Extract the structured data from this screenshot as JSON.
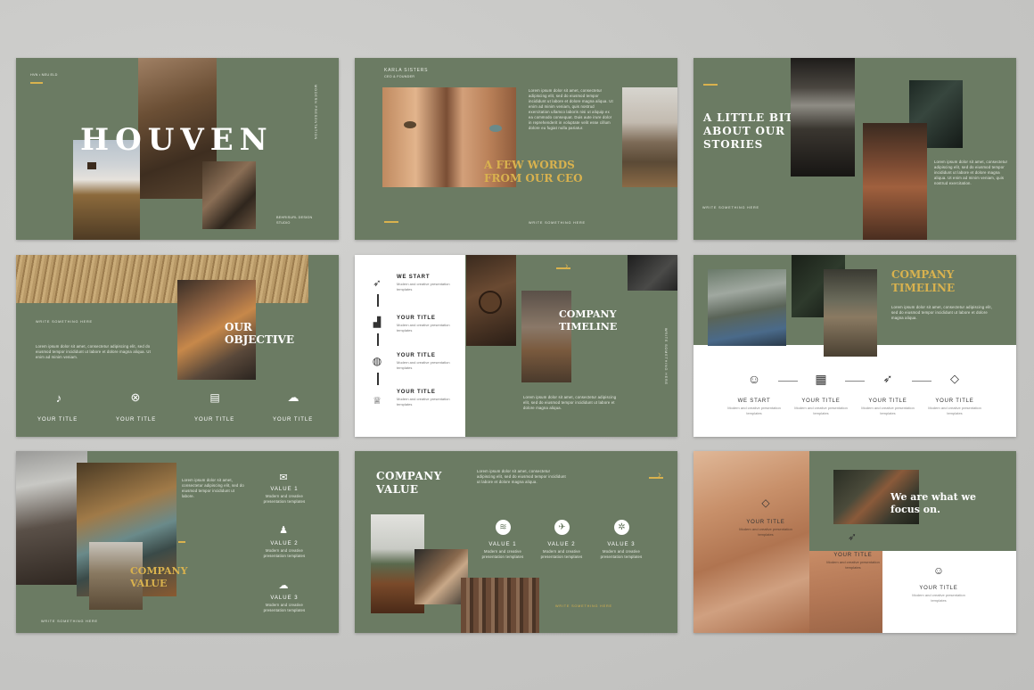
{
  "slide1": {
    "brand_small": "HVN • NEU ELD",
    "title": "HOUVEN",
    "vertical": "MODERN PRESENTATION",
    "studio": "BEHRISURL DESIGN STUDIO"
  },
  "slide2": {
    "name": "KARLA SISTERS",
    "role": "CEO & FOUNDER",
    "heading1": "A FEW WORDS",
    "heading2": "FROM OUR CEO",
    "body": "Lorem ipsum dolor sit amet, consectetur adipiscing elit, sed do eiusmod tempor incididunt ut labore et dolore magna aliqua. Ut enim ad minim veniam, quis nostrud exercitation ullamco laboris nisi ut aliquip ex ea commodo consequat. Duis aute irure dolor in reprehenderit in voluptate velit esse cillum dolore eu fugiat nulla pariatur.",
    "footer": "WRITE SOMETHING HERE"
  },
  "slide3": {
    "heading1": "A LITTLE BIT",
    "heading2": "ABOUT OUR",
    "heading3": "STORIES",
    "footer": "WRITE SOMETHING HERE",
    "body": "Lorem ipsum dolor sit amet, consectetur adipiscing elit, sed do eiusmod tempor incididunt ut labore et dolore magna aliqua. Ut enim ad minim veniam, quis nostrud exercitation."
  },
  "slide4": {
    "footer": "WRITE SOMETHING HERE",
    "body": "Lorem ipsum dolor sit amet, consectetur adipiscing elit, sed do eiusmod tempor incididunt ut labore et dolore magna aliqua. Ut enim ad minim veniam.",
    "heading1": "OUR",
    "heading2": "OBJECTIVE",
    "items": [
      {
        "label": "YOUR TITLE",
        "icon": "music-note-icon"
      },
      {
        "label": "YOUR TITLE",
        "icon": "ball-icon"
      },
      {
        "label": "YOUR TITLE",
        "icon": "document-icon"
      },
      {
        "label": "YOUR TITLE",
        "icon": "cloud-upload-icon"
      }
    ]
  },
  "slide5": {
    "steps": [
      {
        "title": "WE START",
        "sub": "Modern and creative presentation templates",
        "icon": "rocket-icon"
      },
      {
        "title": "YOUR TITLE",
        "sub": "Modern and creative presentation templates",
        "icon": "bar-chart-icon"
      },
      {
        "title": "YOUR TITLE",
        "sub": "Modern and creative presentation templates",
        "icon": "globe-icon"
      },
      {
        "title": "YOUR TITLE",
        "sub": "Modern and creative presentation templates",
        "icon": "trophy-icon"
      }
    ],
    "heading1": "COMPANY",
    "heading2": "TIMELINE",
    "vertical": "WRITE SOMETHING HERE",
    "body": "Lorem ipsum dolor sit amet, consectetur adipiscing elit, sed do eiusmod tempor incididunt ut labore et dolore magna aliqua."
  },
  "slide6": {
    "heading1": "COMPANY",
    "heading2": "TIMELINE",
    "body": "Lorem ipsum dolor sit amet, consectetur adipiscing elit, sed do eiusmod tempor incididunt ut labore et dolore magna aliqua.",
    "items": [
      {
        "title": "WE START",
        "sub": "Modern and creative presentation templates",
        "icon": "head-icon"
      },
      {
        "title": "YOUR TITLE",
        "sub": "Modern and creative presentation templates",
        "icon": "map-icon"
      },
      {
        "title": "YOUR TITLE",
        "sub": "Modern and creative presentation templates",
        "icon": "rocket-icon"
      },
      {
        "title": "YOUR TITLE",
        "sub": "Modern and creative presentation templates",
        "icon": "diamond-icon"
      }
    ]
  },
  "slide7": {
    "body": "Lorem ipsum dolor sit amet, consectetur adipiscing elit, sed do eiusmod tempor incididunt ut labore.",
    "heading1": "COMPANY",
    "heading2": "VALUE",
    "footer": "WRITE SOMETHING HERE",
    "values": [
      {
        "title": "VALUE 1",
        "sub": "Modern and creative presentation templates",
        "icon": "envelope-icon"
      },
      {
        "title": "VALUE 2",
        "sub": "Modern and creative presentation templates",
        "icon": "users-icon"
      },
      {
        "title": "VALUE 3",
        "sub": "Modern and creative presentation templates",
        "icon": "cloud-upload-icon"
      }
    ]
  },
  "slide8": {
    "heading1": "COMPANY",
    "heading2": "VALUE",
    "body": "Lorem ipsum dolor sit amet, consectetur adipiscing elit, sed do eiusmod tempor incididunt ut labore et dolore magna aliqua.",
    "footer": "WRITE SOMETHING HERE",
    "values": [
      {
        "title": "VALUE 1",
        "sub": "Modern and creative presentation templates",
        "icon": "layers-icon"
      },
      {
        "title": "VALUE 2",
        "sub": "Modern and creative presentation templates",
        "icon": "plane-icon"
      },
      {
        "title": "VALUE 3",
        "sub": "Modern and creative presentation templates",
        "icon": "gear-icon"
      }
    ]
  },
  "slide9": {
    "heading1": "We are what we",
    "heading2": "focus on.",
    "items": [
      {
        "title": "YOUR TITLE",
        "sub": "Modern and creative presentation templates",
        "icon": "diamond-icon"
      },
      {
        "title": "YOUR TITLE",
        "sub": "Modern and creative presentation templates",
        "icon": "rocket-icon"
      },
      {
        "title": "YOUR TITLE",
        "sub": "Modern and creative presentation templates",
        "icon": "head-icon"
      }
    ]
  },
  "colors": {
    "slide_green": "#6b7b63",
    "accent_gold": "#d9b24e",
    "paper_white": "#ffffff"
  }
}
